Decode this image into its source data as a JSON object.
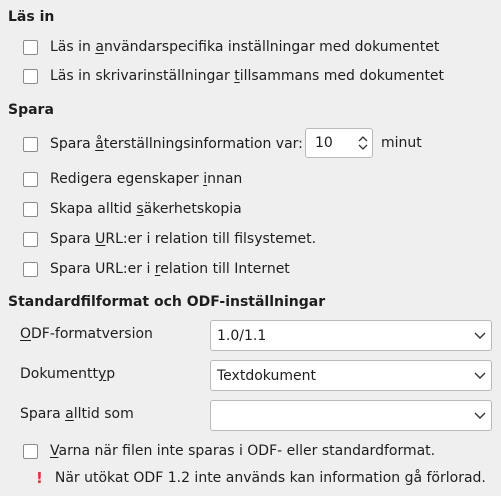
{
  "load": {
    "heading": "Läs in",
    "options": [
      {
        "pre": "Läs in ",
        "u": "a",
        "post": "nvändarspecifika inställningar med dokumentet",
        "checked": false
      },
      {
        "pre": "Läs in skrivarinställningar ",
        "u": "t",
        "post": "illsammans med dokumentet",
        "checked": false
      }
    ]
  },
  "save": {
    "heading": "Spara",
    "autorecovery": {
      "pre": "Spara ",
      "u": "å",
      "post": "terställningsinformation var:",
      "value": "10",
      "unit": "minut",
      "checked": false
    },
    "options": [
      {
        "pre": "Redigera egenskaper ",
        "u": "i",
        "post": "nnan",
        "checked": false
      },
      {
        "pre": "Skapa alltid ",
        "u": "s",
        "post": "äkerhetskopia",
        "checked": false
      },
      {
        "pre": "Spara ",
        "u": "U",
        "post": "RL:er i relation till filsystemet.",
        "checked": false
      },
      {
        "pre": "Spara URL:er i ",
        "u": "r",
        "post": "elation till Internet",
        "checked": false
      }
    ]
  },
  "formats": {
    "heading": "Standardfilformat och ODF-inställningar",
    "odf_version": {
      "pre": "",
      "u": "O",
      "post": "DF-formatversion",
      "value": "1.0/1.1"
    },
    "doc_type": {
      "pre": "Dokumentt",
      "u": "y",
      "post": "p",
      "value": "Textdokument"
    },
    "always_save_as": {
      "pre": "Spara ",
      "u": "a",
      "post": "lltid som",
      "value": ""
    },
    "warn": {
      "pre": "",
      "u": "V",
      "post": "arna när filen inte sparas i ODF- eller standardformat.",
      "checked": false
    },
    "notice": {
      "icon": "exclamation-icon",
      "text": "När utökat ODF 1.2 inte används kan information gå förlorad.",
      "color": "#e0323a"
    }
  }
}
